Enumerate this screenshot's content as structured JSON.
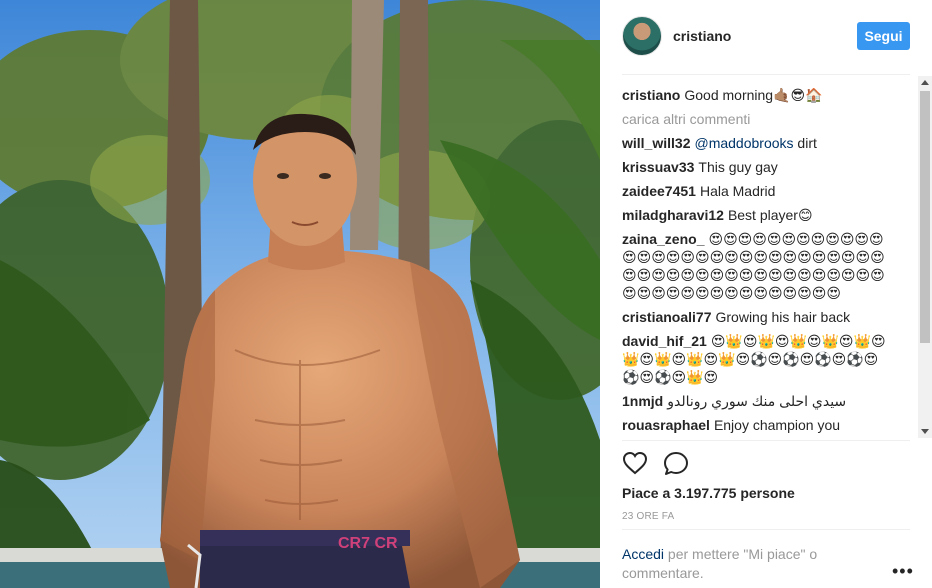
{
  "post": {
    "username": "cristiano",
    "follow_label": "Segui",
    "caption": {
      "author": "cristiano",
      "text": "Good morning🤙🏽😎🏠"
    },
    "load_more_label": "carica altri commenti",
    "comments": [
      {
        "author": "will_will32",
        "mention": "@maddobrooks",
        "text": " dirt"
      },
      {
        "author": "krissuav33",
        "mention": "",
        "text": "This guy gay"
      },
      {
        "author": "zaidee7451",
        "mention": "",
        "text": "Hala Madrid"
      },
      {
        "author": "miladgharavi12",
        "mention": "",
        "text": "Best player😊"
      },
      {
        "author": "zaina_zeno_",
        "mention": "",
        "text": "😍😍😍😍😍😍😍😍😍😍😍😍😍😍😍😍😍😍😍😍😍😍😍😍😍😍😍😍😍😍😍😍😍😍😍😍😍😍😍😍😍😍😍😍😍😍😍😍😍😍😍😍😍😍😍😍😍😍😍😍😍😍😍"
      },
      {
        "author": "cristianoali77",
        "mention": "",
        "text": "Growing his hair back"
      },
      {
        "author": "david_hif_21",
        "mention": "",
        "text": "😍👑😍👑😍👑😍👑😍👑😍👑😍👑😍👑😍👑😍⚽😍⚽😍⚽😍⚽😍⚽😍⚽😍👑😍"
      },
      {
        "author": "1nmjd",
        "mention": "",
        "text": "سيدي احلى منك سوري رونالدو"
      },
      {
        "author": "rouasraphael",
        "mention": "",
        "text": "Enjoy champion you deserve it. And mazaltov for your childrens"
      }
    ],
    "likes_text": "Piace a 3.197.775 persone",
    "timestamp": "23 ORE FA",
    "login_link": "Accedi",
    "login_text": " per mettere \"Mi piace\" o commentare.",
    "more_label": "•••"
  },
  "icons": {
    "like": "heart-outline-icon",
    "comment": "speech-bubble-icon",
    "more": "ellipsis-icon"
  },
  "colors": {
    "follow_button": "#3897f0",
    "link": "#003569",
    "muted": "#999999",
    "text": "#262626"
  }
}
